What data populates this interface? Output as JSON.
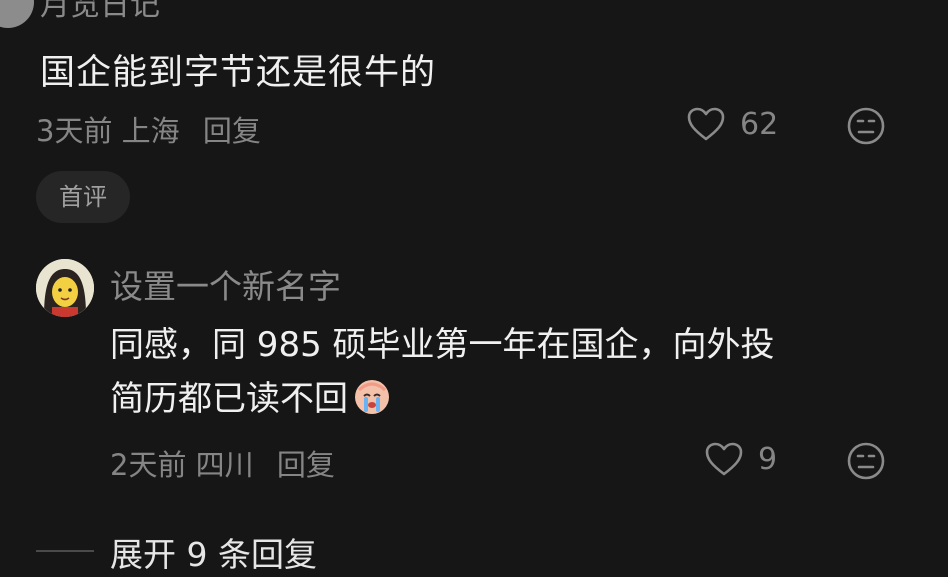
{
  "comment1": {
    "username": "月览日记",
    "text": "国企能到字节还是很牛的",
    "time": "3天前",
    "location": "上海",
    "reply_label": "回复",
    "likes": "62",
    "badge": "首评"
  },
  "comment2": {
    "username": "设置一个新名字",
    "text_line1": "同感，同 985 硕毕业第一年在国企，向外投",
    "text_line2": "简历都已读不回",
    "time": "2天前",
    "location": "四川",
    "reply_label": "回复",
    "likes": "9"
  },
  "expand_replies": "展开 9 条回复",
  "icons": {
    "like": "heart-outline-icon",
    "more": "meh-face-icon",
    "emoji": "crying-face-emoji"
  }
}
